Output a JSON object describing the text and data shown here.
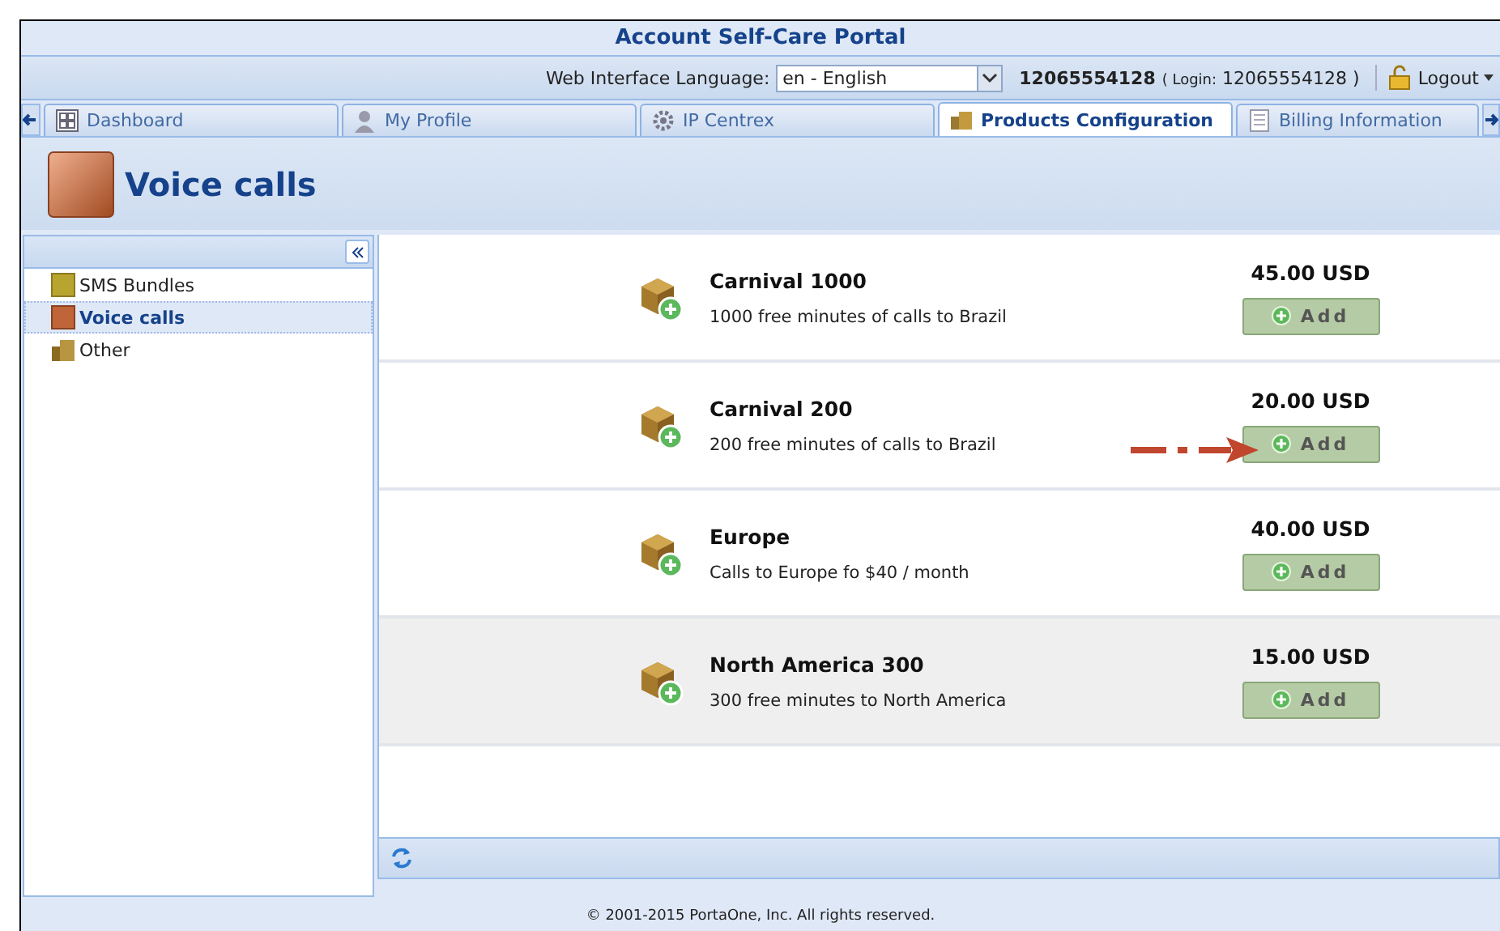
{
  "window": {
    "title": "Account Self-Care Portal"
  },
  "language_bar": {
    "label": "Web Interface Language:",
    "value": "en - English",
    "account": "12065554128",
    "login_label": "( Login:",
    "login": "12065554128 )",
    "logout": "Logout"
  },
  "tabs": [
    {
      "label": "Dashboard",
      "selected": false
    },
    {
      "label": "My Profile",
      "selected": false
    },
    {
      "label": "IP Centrex",
      "selected": false
    },
    {
      "label": "Products Configuration",
      "selected": true
    },
    {
      "label": "Billing Information",
      "selected": false
    }
  ],
  "page_heading": "Voice calls",
  "sidebar": {
    "items": [
      {
        "label": "SMS Bundles",
        "selected": false
      },
      {
        "label": "Voice calls",
        "selected": true
      },
      {
        "label": "Other",
        "selected": false
      }
    ]
  },
  "products": [
    {
      "name": "Carnival 1000",
      "description": "1000 free minutes of calls to Brazil",
      "price": "45.00 USD",
      "button": "Add",
      "highlighted": false,
      "pointer_arrow": false
    },
    {
      "name": "Carnival 200",
      "description": "200 free minutes of calls to Brazil",
      "price": "20.00 USD",
      "button": "Add",
      "highlighted": false,
      "pointer_arrow": true
    },
    {
      "name": "Europe",
      "description": "Calls to Europe fo $40 / month",
      "price": "40.00 USD",
      "button": "Add",
      "highlighted": false,
      "pointer_arrow": false
    },
    {
      "name": "North America 300",
      "description": "300 free minutes to North America",
      "price": "15.00 USD",
      "button": "Add",
      "highlighted": true,
      "pointer_arrow": false
    }
  ],
  "footer": "© 2001-2015 PortaOne, Inc. All rights reserved."
}
